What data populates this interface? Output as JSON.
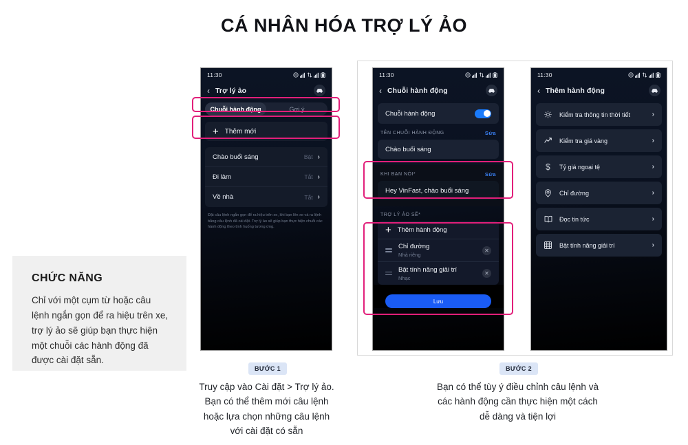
{
  "title": "CÁ NHÂN HÓA TRỢ LÝ ẢO",
  "info_panel": {
    "heading": "CHỨC NĂNG",
    "body": "Chỉ với một cụm từ hoặc câu lệnh ngắn gọn để ra hiệu trên xe, trợ lý ảo sẽ giúp bạn thực hiện một chuỗi các hành động đã được cài đặt sẵn."
  },
  "phone1": {
    "status_time": "11:30",
    "nav_title": "Trợ lý ảo",
    "tabs": [
      {
        "label": "Chuỗi hành động",
        "active": true
      },
      {
        "label": "Gợi ý",
        "active": false
      }
    ],
    "add_new": "Thêm mới",
    "rows": [
      {
        "label": "Chào buổi sáng",
        "status": "Bật"
      },
      {
        "label": "Đi làm",
        "status": "Tắt"
      },
      {
        "label": "Về nhà",
        "status": "Tắt"
      }
    ],
    "footnote": "Đặt câu lệnh ngắn gọn để ra hiệu trên xe, khi bạn lên xe và ra lệnh bằng câu lệnh đã cài đặt. Trợ lý ảo sẽ giúp bạn thực hiện chuỗi các hành động theo tình huống tương ứng."
  },
  "phone2": {
    "status_time": "11:30",
    "nav_title": "Chuỗi hành động",
    "toggle_label": "Chuỗi hành động",
    "toggle_on": true,
    "name_section_label": "TÊN CHUỖI HÀNH ĐỘNG",
    "name_edit": "Sửa",
    "name_value": "Chào buổi sáng",
    "phrase_section_label": "KHI BẠN NÓI*",
    "phrase_edit": "Sửa",
    "phrase_value": "Hey VinFast, chào buổi sáng",
    "assistant_section_label": "TRỢ LÝ ẢO SẼ*",
    "add_action": "Thêm hành động",
    "actions": [
      {
        "title": "Chỉ đường",
        "sub": "Nhà riêng"
      },
      {
        "title": "Bật tính năng giải trí",
        "sub": "Nhạc"
      }
    ],
    "save_label": "Lưu"
  },
  "phone3": {
    "status_time": "11:30",
    "nav_title": "Thêm hành động",
    "items": [
      {
        "label": "Kiểm tra thông tin thời tiết",
        "icon": "sun-icon"
      },
      {
        "label": "Kiểm tra giá vàng",
        "icon": "trend-up-icon"
      },
      {
        "label": "Tỷ giá ngoại tệ",
        "icon": "dollar-icon"
      },
      {
        "label": "Chỉ đường",
        "icon": "location-pin-icon"
      },
      {
        "label": "Đọc tin tức",
        "icon": "book-icon"
      },
      {
        "label": "Bật tính năng giải trí",
        "icon": "film-icon"
      }
    ]
  },
  "steps": [
    {
      "badge": "BƯỚC 1",
      "text": "Truy cập vào Cài đặt > Trợ lý ảo. Bạn có thể thêm mới câu lệnh hoặc lựa chọn những câu lệnh với cài đặt có sẵn"
    },
    {
      "badge": "BƯỚC 2",
      "text": "Bạn có thể tùy ý điều chỉnh câu lệnh và các hành động cần thực hiện một cách dễ dàng và tiện lợi"
    }
  ],
  "colors": {
    "highlight_pink": "#e21f7a",
    "accent_blue": "#1a5cf5",
    "link_blue": "#3b82f6",
    "badge_bg": "#dbe5f6",
    "panel_bg": "#f0f0f0"
  },
  "chevron": "›",
  "plus": "+",
  "back": "‹",
  "close": "✕"
}
